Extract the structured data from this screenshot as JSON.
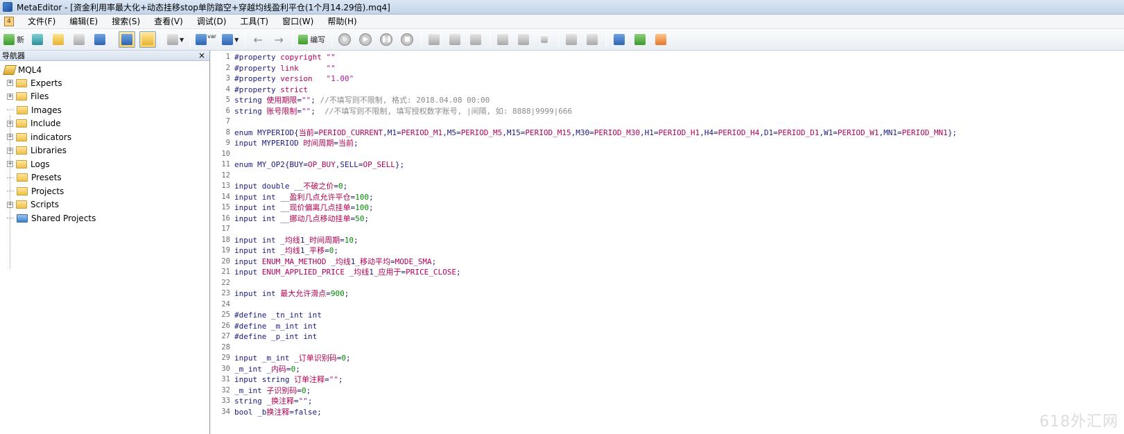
{
  "window": {
    "title": "MetaEditor - [资金利用率最大化+动态挂移stop单防踏空+穿越均线盈利平仓(1个月14.29倍).mq4]"
  },
  "menu": {
    "items": [
      "文件(F)",
      "编辑(E)",
      "搜索(S)",
      "查看(V)",
      "调试(D)",
      "工具(T)",
      "窗口(W)",
      "帮助(H)"
    ]
  },
  "toolbar": {
    "new_label": "新",
    "var_label": "var",
    "compile_label": "编写"
  },
  "navigator": {
    "title": "导航器",
    "close": "×",
    "root": "MQL4",
    "items": [
      {
        "label": "Experts",
        "expandable": true
      },
      {
        "label": "Files",
        "expandable": true
      },
      {
        "label": "Images",
        "expandable": false
      },
      {
        "label": "Include",
        "expandable": true
      },
      {
        "label": "indicators",
        "expandable": true
      },
      {
        "label": "Libraries",
        "expandable": true
      },
      {
        "label": "Logs",
        "expandable": true
      },
      {
        "label": "Presets",
        "expandable": false
      },
      {
        "label": "Projects",
        "expandable": false
      },
      {
        "label": "Scripts",
        "expandable": true
      },
      {
        "label": "Shared Projects",
        "expandable": false,
        "shared": true
      }
    ]
  },
  "editor": {
    "lines": [
      "#property copyright \"\"",
      "#property link      \"\"",
      "#property version   \"1.00\"",
      "#property strict",
      "string 使用期限=\"\"; //不填写则不限制, 格式: 2018.04.08 00:00",
      "string 账号限制=\"\";  //不填写则不限制, 填写授权数字账号, |间隔, 如: 8888|9999|666",
      "",
      "enum MYPERIOD{当前=PERIOD_CURRENT,M1=PERIOD_M1,M5=PERIOD_M5,M15=PERIOD_M15,M30=PERIOD_M30,H1=PERIOD_H1,H4=PERIOD_H4,D1=PERIOD_D1,W1=PERIOD_W1,MN1=PERIOD_MN1};",
      "input MYPERIOD 时间周期=当前;",
      "",
      "enum MY_OP2{BUY=OP_BUY,SELL=OP_SELL};",
      "",
      "input double __不破之价=0;",
      "input int __盈利几点允许平仓=100;",
      "input int __现价偏离几点挂单=100;",
      "input int __挪动几点移动挂单=50;",
      "",
      "input int _均线1_时间周期=10;",
      "input int _均线1_平移=0;",
      "input ENUM_MA_METHOD _均线1_移动平均=MODE_SMA;",
      "input ENUM_APPLIED_PRICE _均线1_应用于=PRICE_CLOSE;",
      "",
      "input int 最大允许滑点=900;",
      "",
      "#define _tn_int int",
      "#define _m_int int",
      "#define _p_int int",
      "",
      "input _m_int _订单识别码=0;",
      "_m_int _内码=0;",
      "input string 订单注释=\"\";",
      "_m_int 子识别码=0;",
      "string _换注释=\"\";",
      "bool _b换注释=false;"
    ],
    "watermark": "618外汇网"
  }
}
